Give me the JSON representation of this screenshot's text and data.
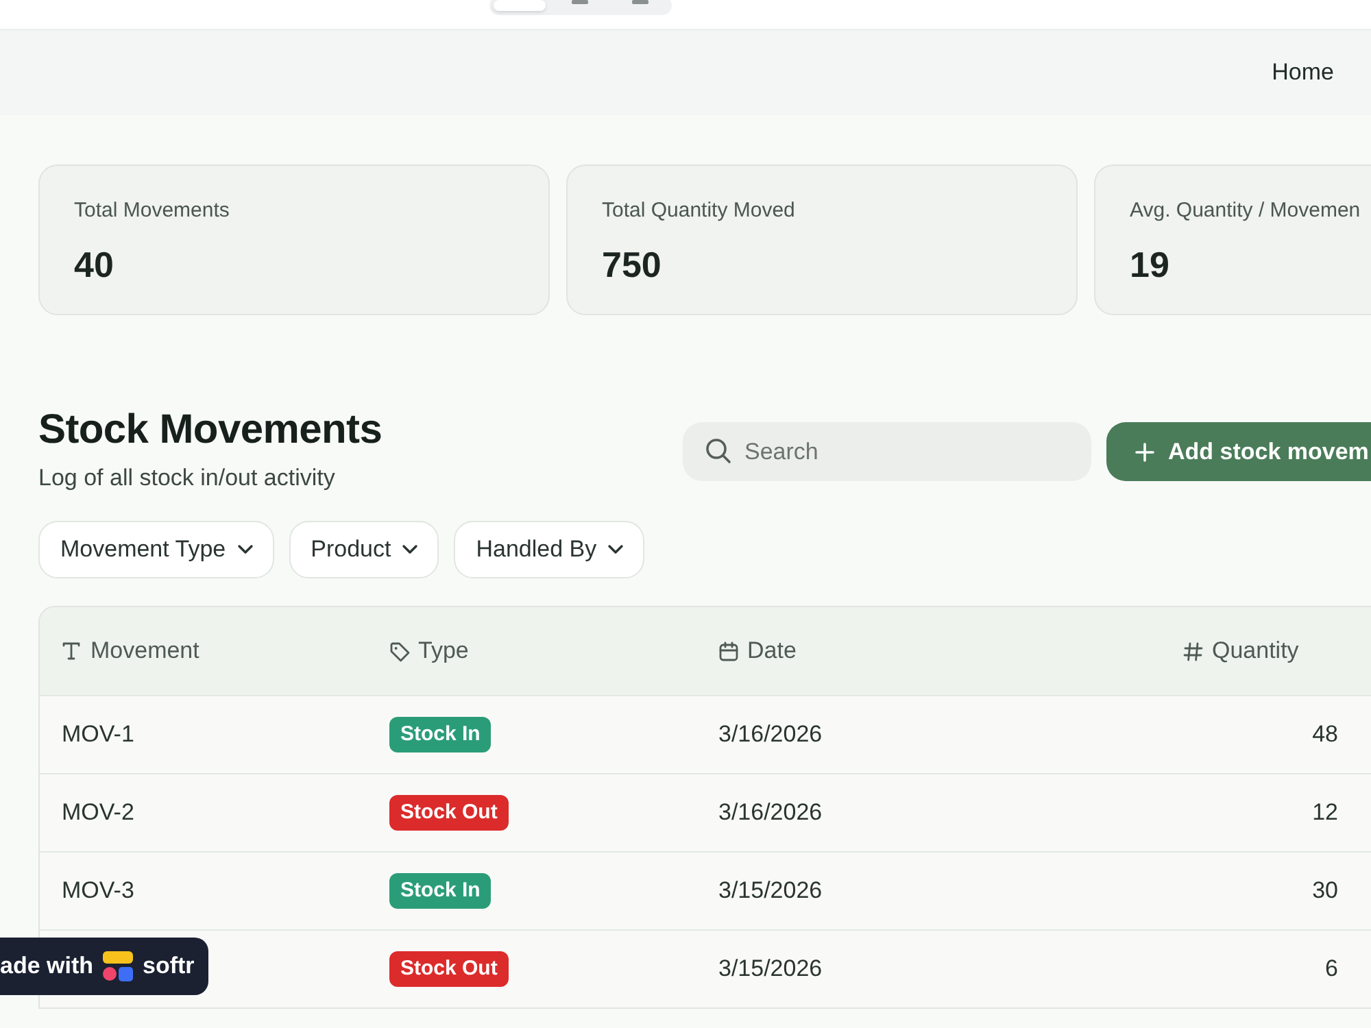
{
  "top_toggle": {
    "segments": [
      {
        "selected": true
      },
      {
        "selected": false
      },
      {
        "selected": false
      }
    ]
  },
  "nav": {
    "links": [
      "Home"
    ]
  },
  "stats": [
    {
      "label": "Total Movements",
      "value": "40"
    },
    {
      "label": "Total Quantity Moved",
      "value": "750"
    },
    {
      "label": "Avg. Quantity / Movemen",
      "value": "19"
    }
  ],
  "section": {
    "title": "Stock Movements",
    "subtitle": "Log of all stock in/out activity",
    "search": {
      "placeholder": "Search"
    },
    "add_button": "Add stock movem",
    "filters": [
      "Movement Type",
      "Product",
      "Handled By"
    ]
  },
  "table": {
    "columns": [
      {
        "label": "Movement",
        "kind": "text"
      },
      {
        "label": "Type",
        "kind": "tag"
      },
      {
        "label": "Date",
        "kind": "date"
      },
      {
        "label": "Quantity",
        "kind": "number"
      }
    ],
    "rows": [
      {
        "movement": "MOV-1",
        "type": {
          "label": "Stock In",
          "color": "#2a9d78"
        },
        "date": "3/16/2026",
        "quantity": "48"
      },
      {
        "movement": "MOV-2",
        "type": {
          "label": "Stock Out",
          "color": "#dc2b2b"
        },
        "date": "3/16/2026",
        "quantity": "12"
      },
      {
        "movement": "MOV-3",
        "type": {
          "label": "Stock In",
          "color": "#2a9d78"
        },
        "date": "3/15/2026",
        "quantity": "30"
      },
      {
        "type": {
          "label": "Stock Out",
          "color": "#dc2b2b"
        },
        "date": "3/15/2026",
        "quantity": "6"
      }
    ]
  },
  "badge": {
    "text": "ade with",
    "brand": "softr"
  }
}
